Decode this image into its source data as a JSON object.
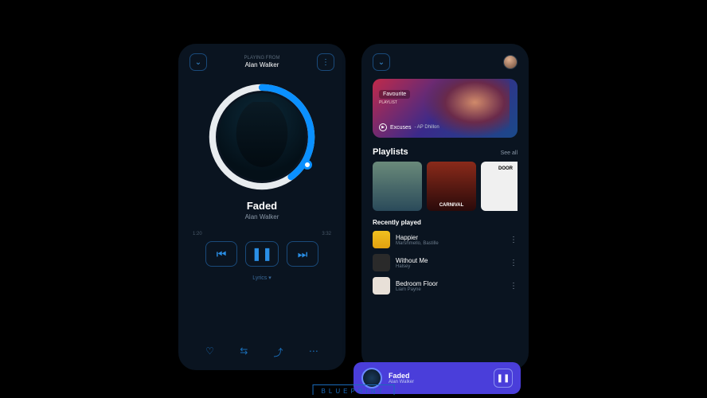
{
  "left": {
    "header_label": "PLAYING FROM",
    "header_artist": "Alan Walker",
    "track_title": "Faded",
    "track_artist": "Alan Walker",
    "time_elapsed": "1:20",
    "time_total": "3:32",
    "lyrics_label": "Lyrics ▾"
  },
  "right": {
    "hero": {
      "tag": "Favourite",
      "tag_sub": "PLAYLIST",
      "song": "Excuses",
      "artist": " - AP Dhillon"
    },
    "playlists": {
      "heading": "Playlists",
      "see_all": "See all",
      "items": [
        {
          "label": ""
        },
        {
          "label": "CARNIVAL"
        },
        {
          "label": "DOOR"
        }
      ]
    },
    "recent": {
      "heading": "Recently played",
      "items": [
        {
          "title": "Happier",
          "artist": "Marshmello, Bastille"
        },
        {
          "title": "Without Me",
          "artist": "Halsey"
        },
        {
          "title": "Bedroom Floor",
          "artist": "Liam Payne"
        }
      ]
    }
  },
  "mini": {
    "title": "Faded",
    "artist": "Alan Walker"
  },
  "footer": "BLUEPRINT"
}
